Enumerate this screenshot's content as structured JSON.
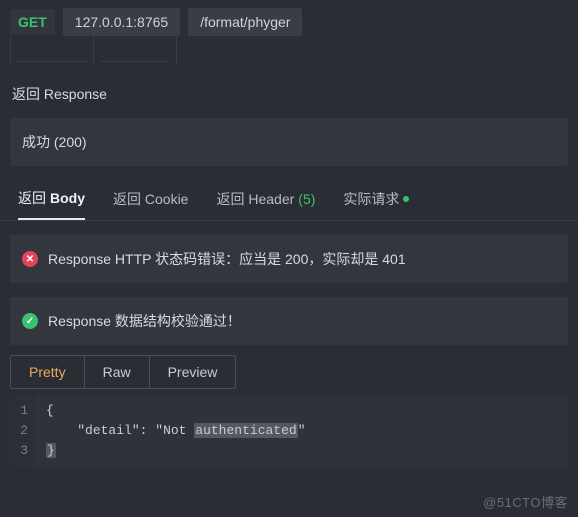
{
  "request": {
    "method": "GET",
    "host": "127.0.0.1:8765",
    "path": "/format/phyger"
  },
  "response_section_title": "返回 Response",
  "response_status": "成功 (200)",
  "tabs": {
    "body_prefix": "返回 ",
    "body": "Body",
    "cookie": "返回 Cookie",
    "header_prefix": "返回 Header ",
    "header_count": "(5)",
    "actual": "实际请求"
  },
  "alerts": {
    "error": "Response HTTP 状态码错误：应当是 200，实际却是 401",
    "ok": "Response 数据结构校验通过！"
  },
  "view_tabs": {
    "pretty": "Pretty",
    "raw": "Raw",
    "preview": "Preview"
  },
  "code": {
    "line_numbers": [
      "1",
      "2",
      "3"
    ],
    "brace_open": "{",
    "indent": "    ",
    "key_q": "\"detail\"",
    "colon": ": ",
    "val_open_q": "\"",
    "val_part1": "Not ",
    "val_part2_hl": "authenticated",
    "val_close_q": "\"",
    "brace_close": "}"
  },
  "watermark": "@51CTO博客"
}
